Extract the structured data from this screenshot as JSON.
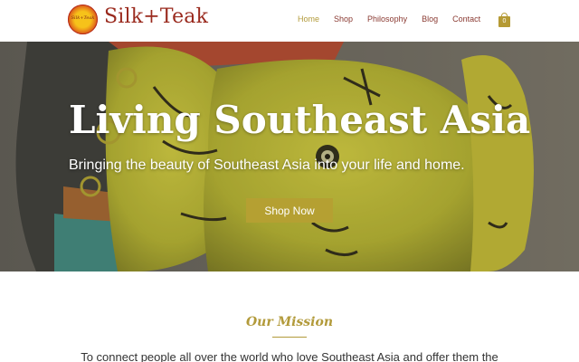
{
  "brand": {
    "name": "Silk+Teak",
    "mark_text": "Silk+Teak"
  },
  "nav": {
    "items": [
      {
        "label": "Home",
        "active": true
      },
      {
        "label": "Shop",
        "active": false
      },
      {
        "label": "Philosophy",
        "active": false
      },
      {
        "label": "Blog",
        "active": false
      },
      {
        "label": "Contact",
        "active": false
      }
    ]
  },
  "cart": {
    "count": "0",
    "icon": "shopping-bag-icon"
  },
  "hero": {
    "title": "Living Southeast Asia",
    "subtitle": "Bringing the beauty of Southeast Asia into your life and home.",
    "cta_label": "Shop Now",
    "background": "yellow-painted-wooden-elephant-photo"
  },
  "mission": {
    "title": "Our Mission",
    "text": "To connect people all over the world who love Southeast Asia and offer them the"
  },
  "colors": {
    "accent_gold": "#b5a032",
    "brand_red": "#9a2a1e",
    "nav_text": "#8a3a32"
  }
}
